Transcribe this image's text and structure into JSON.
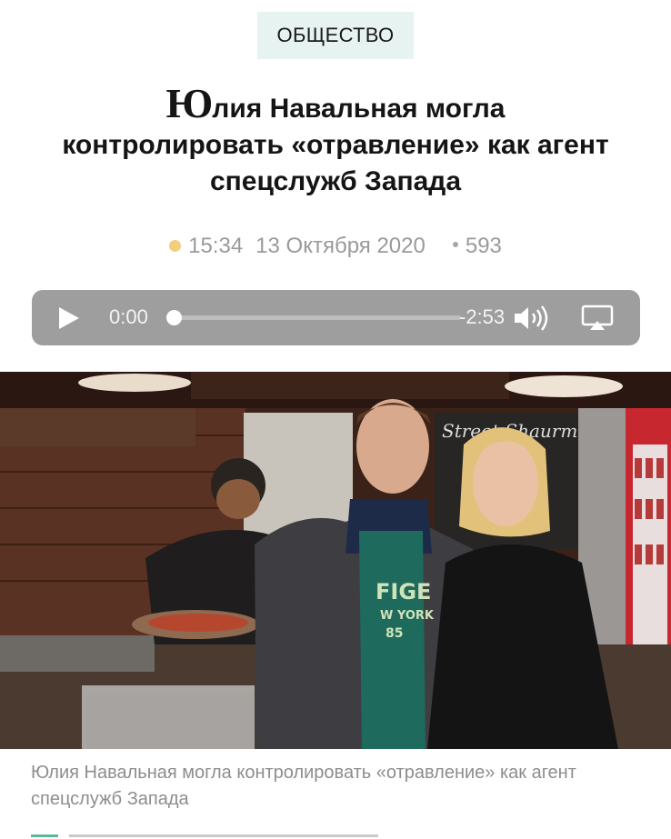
{
  "category": "ОБЩЕСТВО",
  "headline": {
    "dropcap": "Ю",
    "rest_line1": "лия Навальная могла",
    "line2": "контролировать «отравление» как агент",
    "line3": "спецслужб Запада"
  },
  "meta": {
    "time": "15:34",
    "date": "13 Октября 2020",
    "views": "593"
  },
  "player": {
    "current_time": "0:00",
    "remaining_time": "-2:53",
    "progress": 0
  },
  "photo": {
    "sign_text": "Street Shaurma",
    "shirt_text": [
      "FIGE",
      "W YORK",
      "85"
    ]
  },
  "caption": "Юлия Навальная могла контролировать «отравление» как агент спецслужб Запада",
  "colors": {
    "tag_bg": "#e6f3f1",
    "player_bg": "#9e9e9e",
    "meta_dot": "#f2cf7e"
  }
}
